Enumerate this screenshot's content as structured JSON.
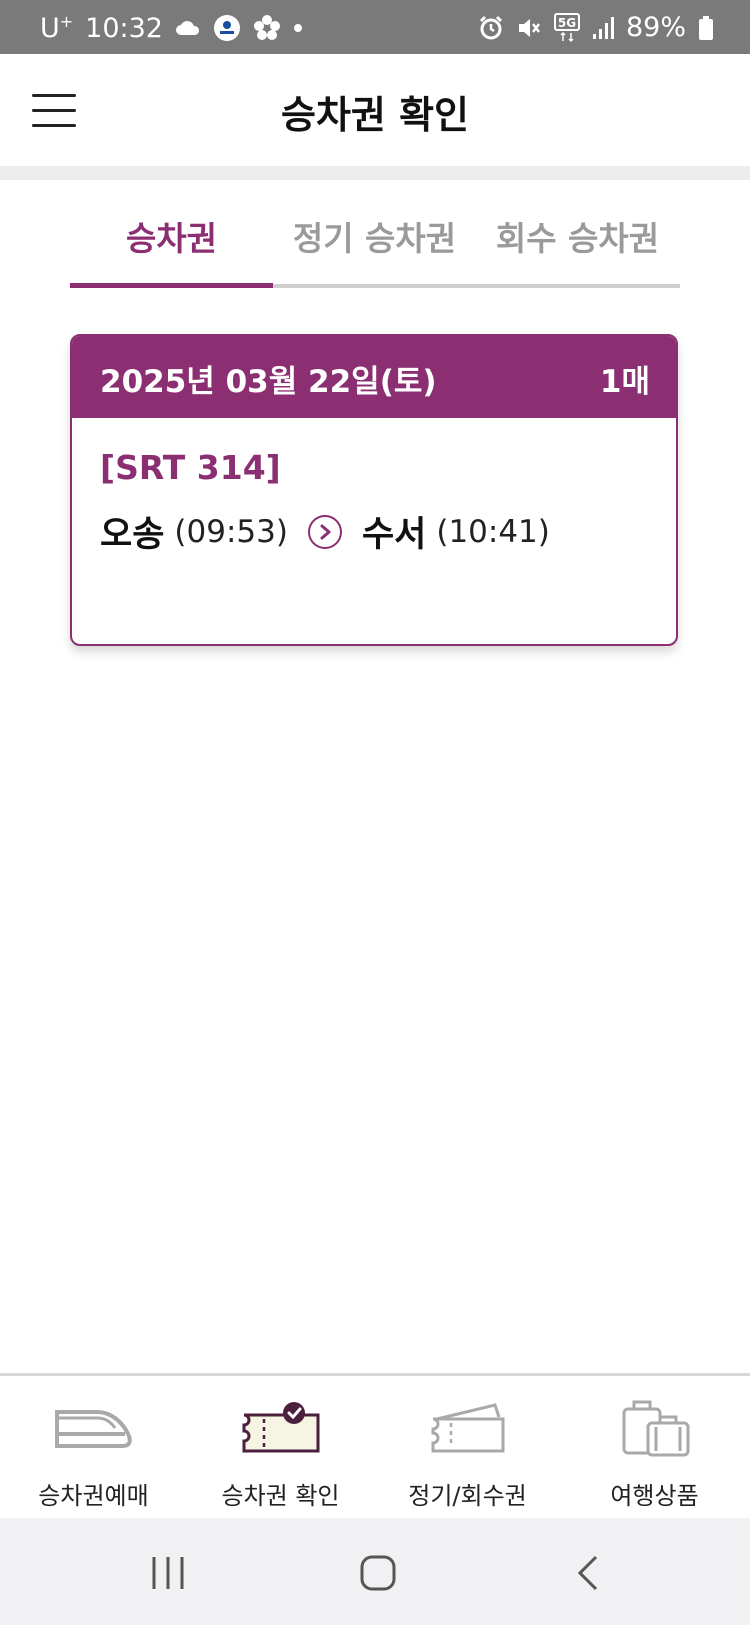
{
  "status_bar": {
    "carrier": "U",
    "carrier_sup": "+",
    "time": "10:32",
    "network": "5G",
    "battery": "89%"
  },
  "header": {
    "title": "승차권 확인"
  },
  "tabs": [
    {
      "label": "승차권",
      "active": true
    },
    {
      "label": "정기 승차권",
      "active": false
    },
    {
      "label": "회수 승차권",
      "active": false
    }
  ],
  "ticket": {
    "date": "2025년 03월 22일(토)",
    "count": "1매",
    "train": "[SRT 314]",
    "departure_station": "오송",
    "departure_time": "(09:53)",
    "arrival_station": "수서",
    "arrival_time": "(10:41)"
  },
  "bottom_nav": [
    {
      "label": "승차권예매",
      "icon": "train-icon"
    },
    {
      "label": "승차권 확인",
      "icon": "ticket-check-icon",
      "active": true
    },
    {
      "label": "정기/회수권",
      "icon": "ticket-icon"
    },
    {
      "label": "여행상품",
      "icon": "luggage-icon"
    }
  ],
  "colors": {
    "brand": "#8c2f72",
    "inactive": "#9a9a9a",
    "status_bar": "#7a7a7a"
  }
}
